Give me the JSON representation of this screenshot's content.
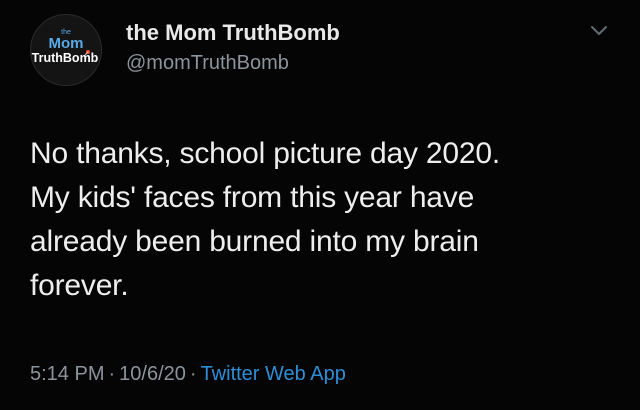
{
  "tweet": {
    "avatar": {
      "icon": "mom-truthbomb-logo",
      "logo_small": "the",
      "logo_mom": "Mom",
      "logo_truthbomb": "TruthBomb",
      "colors": {
        "mom": "#5aa9e6",
        "truthbomb": "#ffffff",
        "fuse": "#ff4b2b"
      }
    },
    "display_name": "the Mom TruthBomb",
    "handle": "@momTruthBomb",
    "menu_icon": "chevron-down-icon",
    "text_lines": [
      "No thanks, school picture day 2020.",
      "My kids' faces from this year have",
      "already been burned into my brain",
      "forever."
    ],
    "time": "5:14 PM",
    "separator": "·",
    "date": "10/6/20",
    "source": "Twitter Web App"
  },
  "colors": {
    "background": "#050505",
    "primary_text": "#eeeeee",
    "secondary_text": "#8b949c",
    "link": "#2e8fd6"
  }
}
